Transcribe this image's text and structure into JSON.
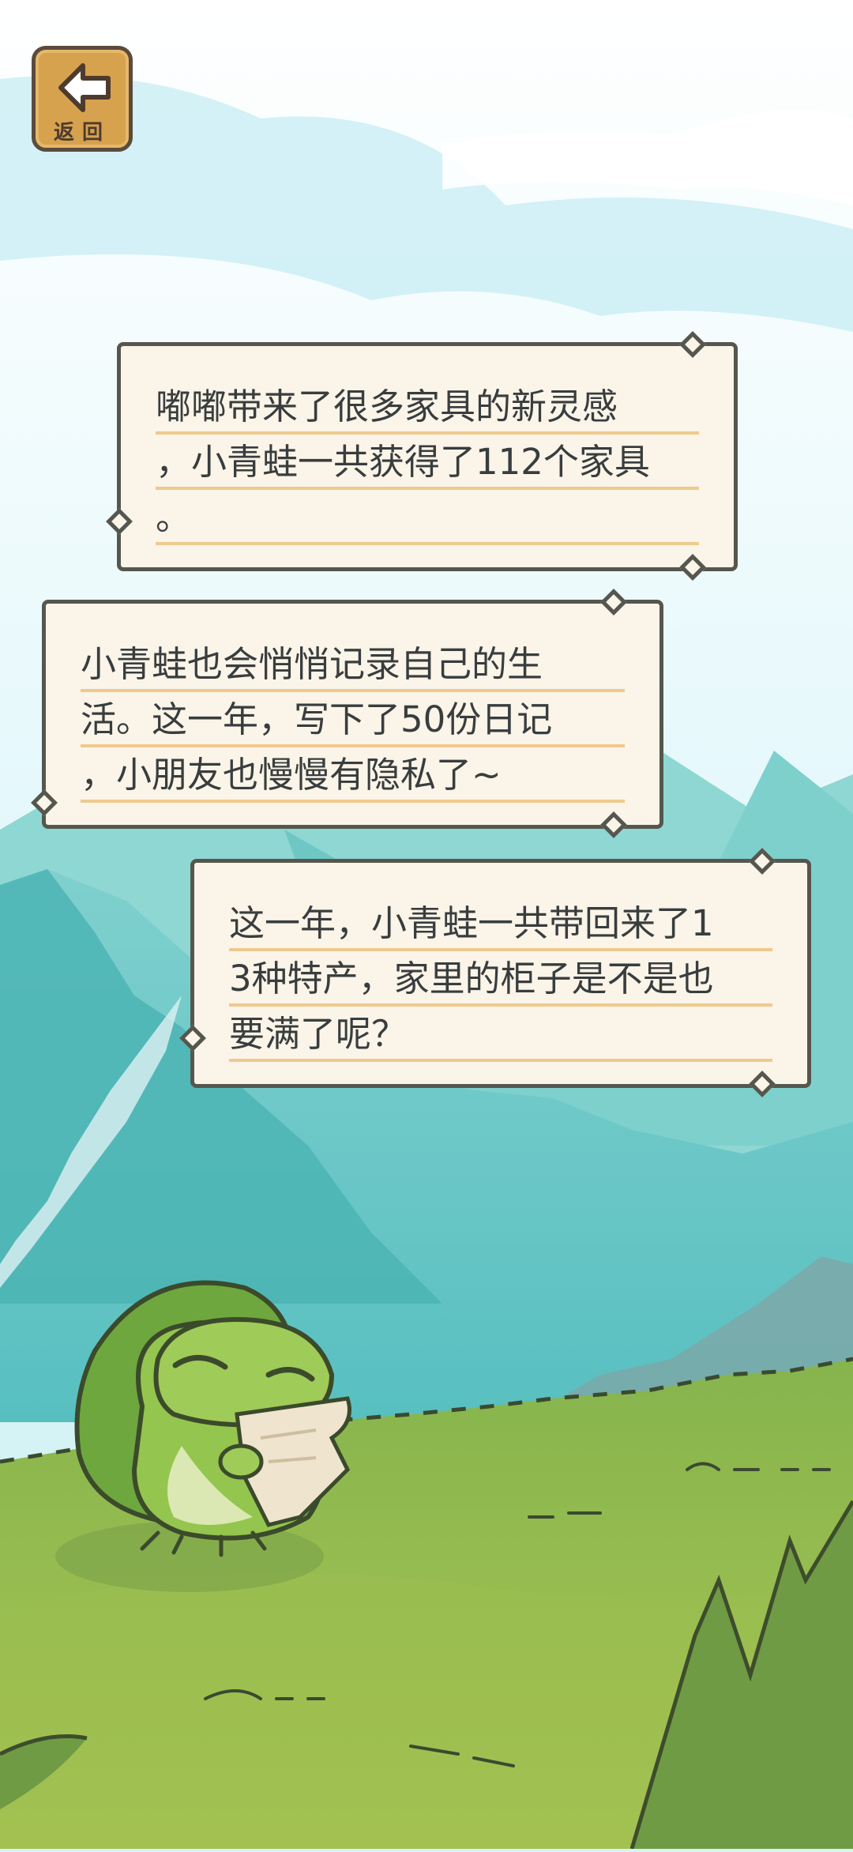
{
  "back_button": {
    "label": "返回"
  },
  "messages": [
    {
      "text": "嘟嘟带来了很多家具的新灵感\n，小青蛙一共获得了112个家具\n。"
    },
    {
      "text": "小青蛙也会悄悄记录自己的生\n活。这一年，写下了50份日记\n，小朋友也慢慢有隐私了~"
    },
    {
      "text": "这一年，小青蛙一共带回来了1\n3种特产，家里的柜子是不是也\n要满了呢？"
    }
  ],
  "colors": {
    "sky": "#d9f3f6",
    "mountain": "#67c7c3",
    "grass": "#8ab44c",
    "frog": "#95c752",
    "bubble_fill": "#fbf4e8",
    "bubble_border": "#55574f",
    "underline": "#efc98e"
  }
}
